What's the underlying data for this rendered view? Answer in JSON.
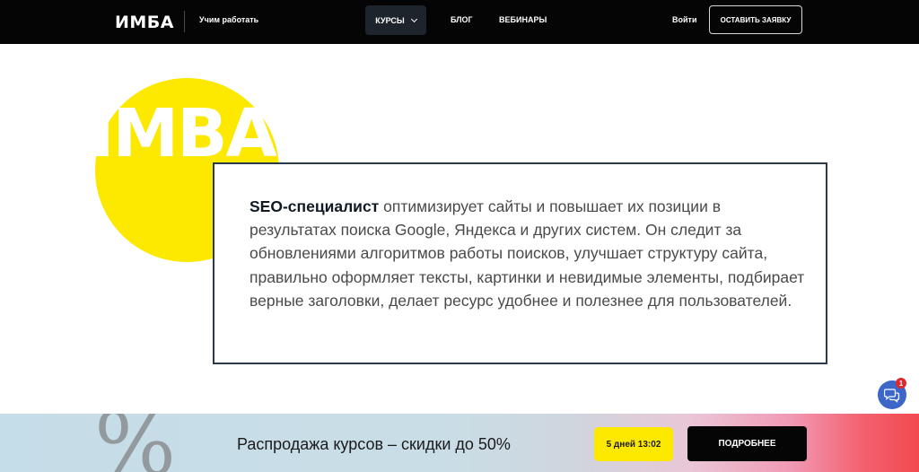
{
  "header": {
    "logo": "ИМБА",
    "tagline": "Учим работать",
    "nav": {
      "courses": "КУРСЫ",
      "blog": "БЛОГ",
      "webinars": "ВЕБИНАРЫ"
    },
    "login": "Войти",
    "apply": "ОСТАВИТЬ ЗАЯВКУ"
  },
  "hero": {
    "logo_text": "IMBA",
    "description_bold": "SEO-специалист",
    "description": " оптимизирует сайты и повышает их позиции в результатах поиска Google, Яндекса и других систем. Он следит за обновлениями алгоритмов работы поисков, улучшает структуру сайта, правильно оформляет тексты, картинки и невидимые элементы, подбирает верные заголовки, делает ресурс удобнее и полезнее для пользователей."
  },
  "chat": {
    "badge_count": "1",
    "icon": "chat-bubbles-icon"
  },
  "banner": {
    "decoration": "%",
    "text": "Распродажа курсов – скидки до 50%",
    "timer": "5 дней 13:02",
    "button": "ПОДРОБНЕЕ"
  },
  "colors": {
    "header_bg": "#050505",
    "accent_yellow": "#fde800",
    "box_border": "#2a3a4a",
    "chat_blue": "#3c67c8",
    "badge_red": "#e0282a"
  }
}
